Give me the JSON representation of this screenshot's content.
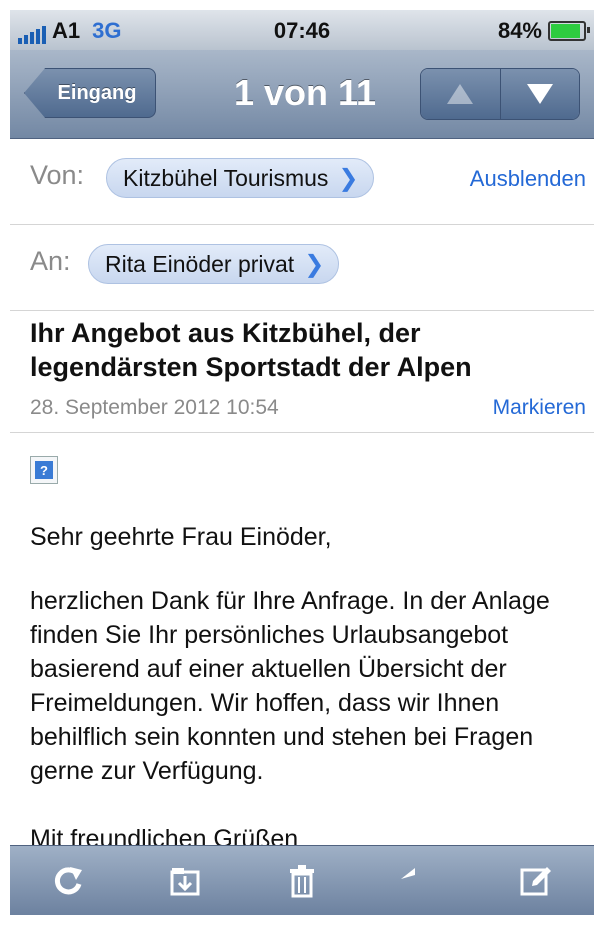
{
  "status_bar": {
    "carrier": "A1",
    "network": "3G",
    "time": "07:46",
    "battery": "84%",
    "battery_level": 0.84
  },
  "nav": {
    "back_label": "Eingang",
    "title": "1 von 11",
    "prev_icon": "arrow-up-icon",
    "next_icon": "arrow-down-icon"
  },
  "header": {
    "from_label": "Von:",
    "from_value": "Kitzbühel Tourismus",
    "hide_label": "Ausblenden",
    "to_label": "An:",
    "to_value": "Rita Einöder privat",
    "subject": "Ihr Angebot aus Kitzbühel, der legendärsten Sportstadt der Alpen",
    "date": "28. September 2012 10:54",
    "mark_label": "Markieren"
  },
  "body": {
    "greeting": "Sehr geehrte Frau Einöder,",
    "paragraph": "herzlichen Dank für Ihre Anfrage. In der Anlage finden Sie Ihr persönliches Urlaubsangebot basierend auf einer aktuellen Übersicht der Freimeldungen. Wir hoffen, dass wir Ihnen behilflich sein konnten und stehen bei Fragen gerne zur Verfügung.",
    "closing": "Mit freundlichen Grüßen",
    "image_placeholder": "?"
  },
  "toolbar": {
    "icons": [
      "refresh-icon",
      "move-folder-icon",
      "trash-icon",
      "reply-icon",
      "compose-icon"
    ]
  },
  "colors": {
    "accent": "#2469d6",
    "navbar": "#7388a4",
    "pill": "#c8d7ef"
  }
}
